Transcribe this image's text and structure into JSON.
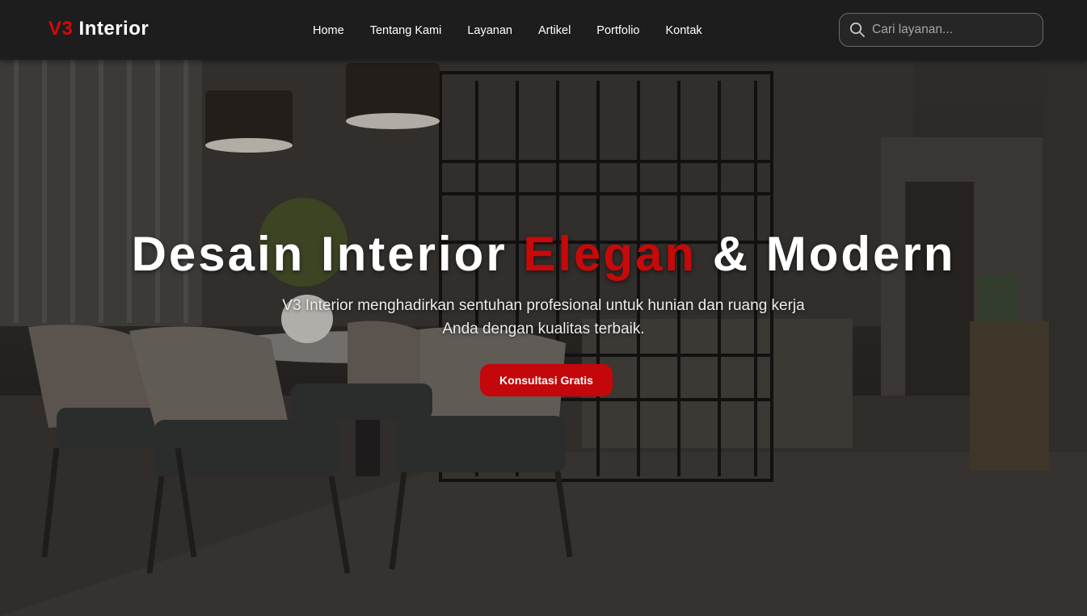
{
  "brand": {
    "accent": "V3",
    "rest": "Interior",
    "accent_color": "#d10a0a"
  },
  "nav": {
    "items": [
      {
        "label": "Home"
      },
      {
        "label": "Tentang Kami"
      },
      {
        "label": "Layanan"
      },
      {
        "label": "Artikel"
      },
      {
        "label": "Portfolio"
      },
      {
        "label": "Kontak"
      }
    ]
  },
  "search": {
    "placeholder": "Cari layanan...",
    "value": "",
    "icon": "search-icon"
  },
  "hero": {
    "title_part1": "Desain Interior ",
    "title_highlight": "Elegan",
    "title_part2": " & Modern",
    "highlight_color": "#c8090a",
    "subtitle": "V3 Interior menghadirkan sentuhan profesional untuk hunian dan ruang kerja Anda dengan kualitas terbaik.",
    "cta_label": "Konsultasi Gratis",
    "cta_color": "#c4070a"
  }
}
